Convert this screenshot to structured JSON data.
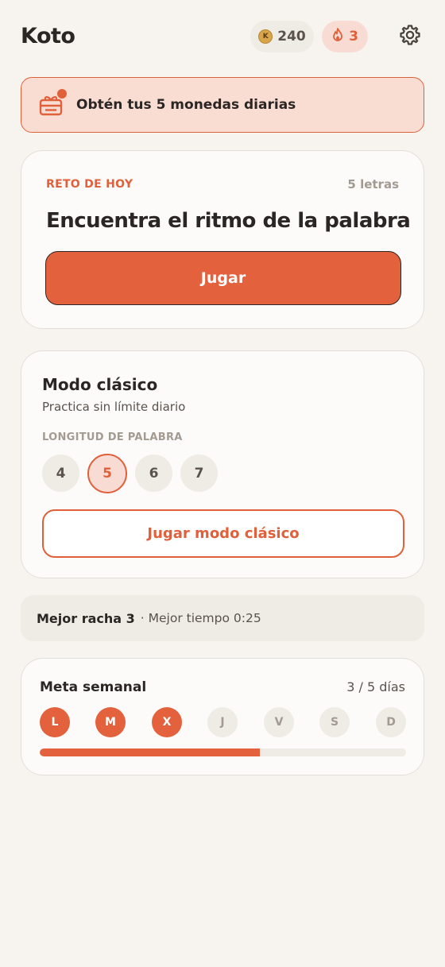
{
  "header": {
    "app_name": "Koto",
    "coin_symbol": "K",
    "coins": "240",
    "streak": "3"
  },
  "banner": {
    "text": "Obtén tus 5 monedas diarias"
  },
  "daily": {
    "eyebrow": "RETO DE HOY",
    "letters": "5 letras",
    "title": "Encuentra el ritmo de la palabra",
    "play_label": "Jugar"
  },
  "classic": {
    "title": "Modo clásico",
    "subtitle": "Practica sin límite diario",
    "length_label": "LONGITUD DE PALABRA",
    "lengths": [
      "4",
      "5",
      "6",
      "7"
    ],
    "selected_length": "5",
    "button_label": "Jugar modo clásico"
  },
  "stats": {
    "best_streak": "Mejor racha 3",
    "best_time": "· Mejor tiempo 0:25"
  },
  "weekly": {
    "title": "Meta semanal",
    "count": "3 / 5 días",
    "days": [
      "L",
      "M",
      "X",
      "J",
      "V",
      "S",
      "D"
    ],
    "completed_days": 3,
    "progress": 0.6
  },
  "colors": {
    "accent": "#e3613c",
    "accent_light": "#f8dcd3",
    "background": "#f7f4ef",
    "text": "#2b2623",
    "muted": "#a39a92"
  }
}
